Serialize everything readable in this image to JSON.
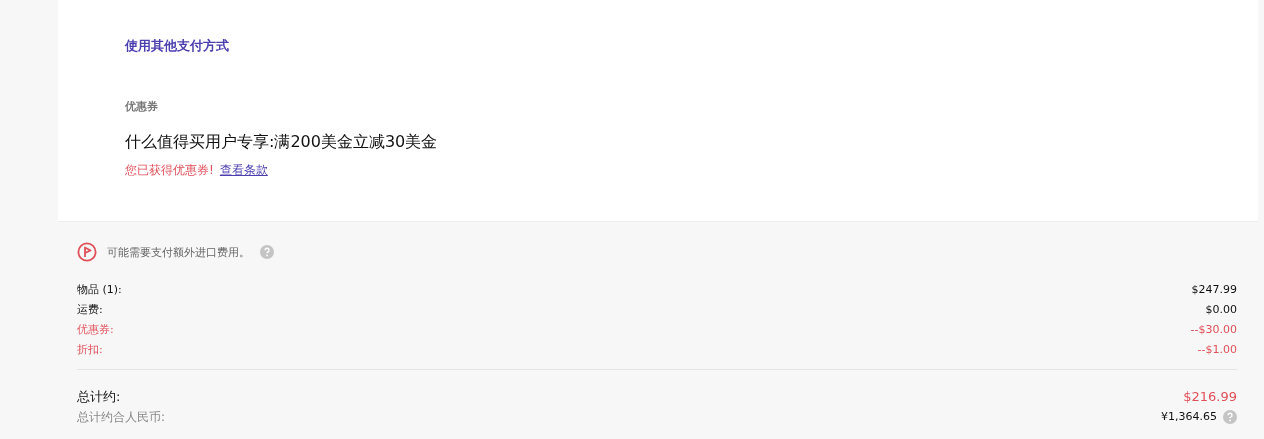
{
  "payment": {
    "other_method_link": "使用其他支付方式"
  },
  "coupon": {
    "section_label": "优惠券",
    "title": "什么值得买用户专享:满200美金立减30美金",
    "status": "您已获得优惠券!",
    "terms_link": "查看条款"
  },
  "import_notice": "可能需要支付额外进口费用。",
  "summary_lines": [
    {
      "label": "物品 (1):",
      "value": "$247.99",
      "kind": "charge"
    },
    {
      "label": "运费:",
      "value": "$0.00",
      "kind": "charge"
    },
    {
      "label": "优惠券:",
      "value": "--$30.00",
      "kind": "discount"
    },
    {
      "label": "折扣:",
      "value": "--$1.00",
      "kind": "discount"
    }
  ],
  "total": {
    "label": "总计约:",
    "value": "$216.99"
  },
  "total_cny": {
    "label": "总计约合人民币:",
    "value": "¥1,364.65"
  }
}
